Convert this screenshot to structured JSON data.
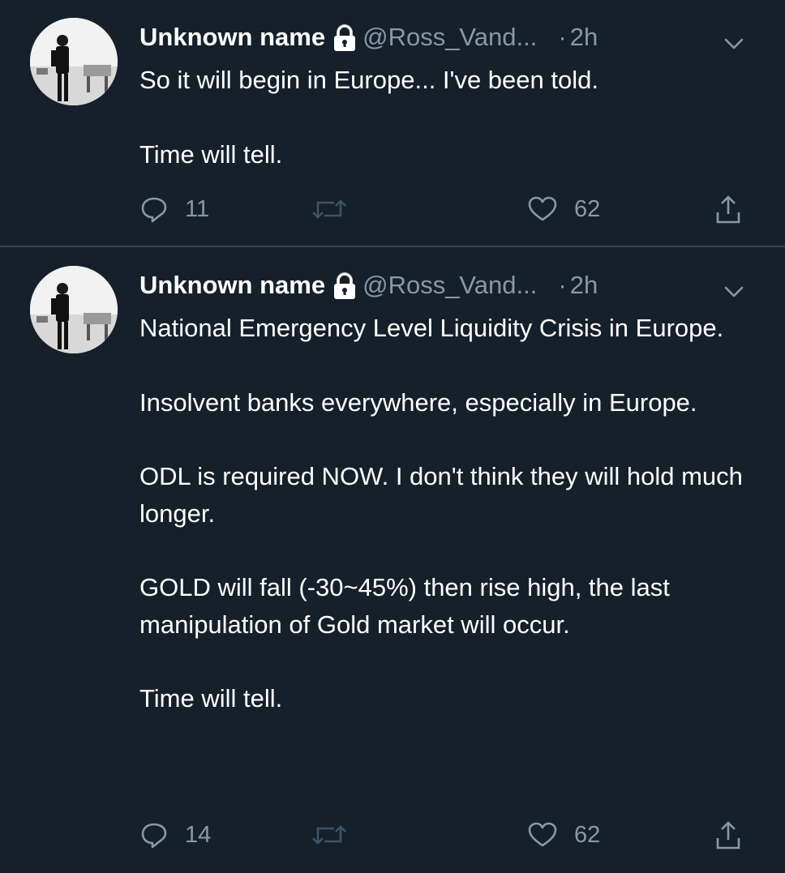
{
  "colors": {
    "background": "#15202b",
    "divider": "#38444d",
    "primary_text": "#ffffff",
    "secondary_text": "#8899a6"
  },
  "tweets": [
    {
      "name": "Unknown name",
      "protected_icon": "lock-icon",
      "handle": "@Ross_Vand...",
      "dot": "·",
      "time": "2h",
      "caret_icon": "chevron-down-icon",
      "paragraphs": [
        "So it will begin in Europe... I've been told.",
        "Time will tell."
      ],
      "actions": {
        "reply_icon": "reply-icon",
        "reply_count": "11",
        "retweet_icon": "retweet-icon",
        "like_icon": "heart-icon",
        "like_count": "62",
        "share_icon": "share-icon"
      }
    },
    {
      "name": "Unknown name",
      "protected_icon": "lock-icon",
      "handle": "@Ross_Vand...",
      "dot": "·",
      "time": "2h",
      "caret_icon": "chevron-down-icon",
      "paragraphs": [
        "National Emergency Level Liquidity Crisis in Europe.",
        "Insolvent banks everywhere, especially in Europe.",
        "ODL is required NOW. I don't think they will hold much longer.",
        "GOLD will fall (-30~45%) then rise high, the last manipulation of Gold market will occur.",
        "Time will tell."
      ],
      "actions": {
        "reply_icon": "reply-icon",
        "reply_count": "14",
        "retweet_icon": "retweet-icon",
        "like_icon": "heart-icon",
        "like_count": "62",
        "share_icon": "share-icon"
      }
    }
  ]
}
